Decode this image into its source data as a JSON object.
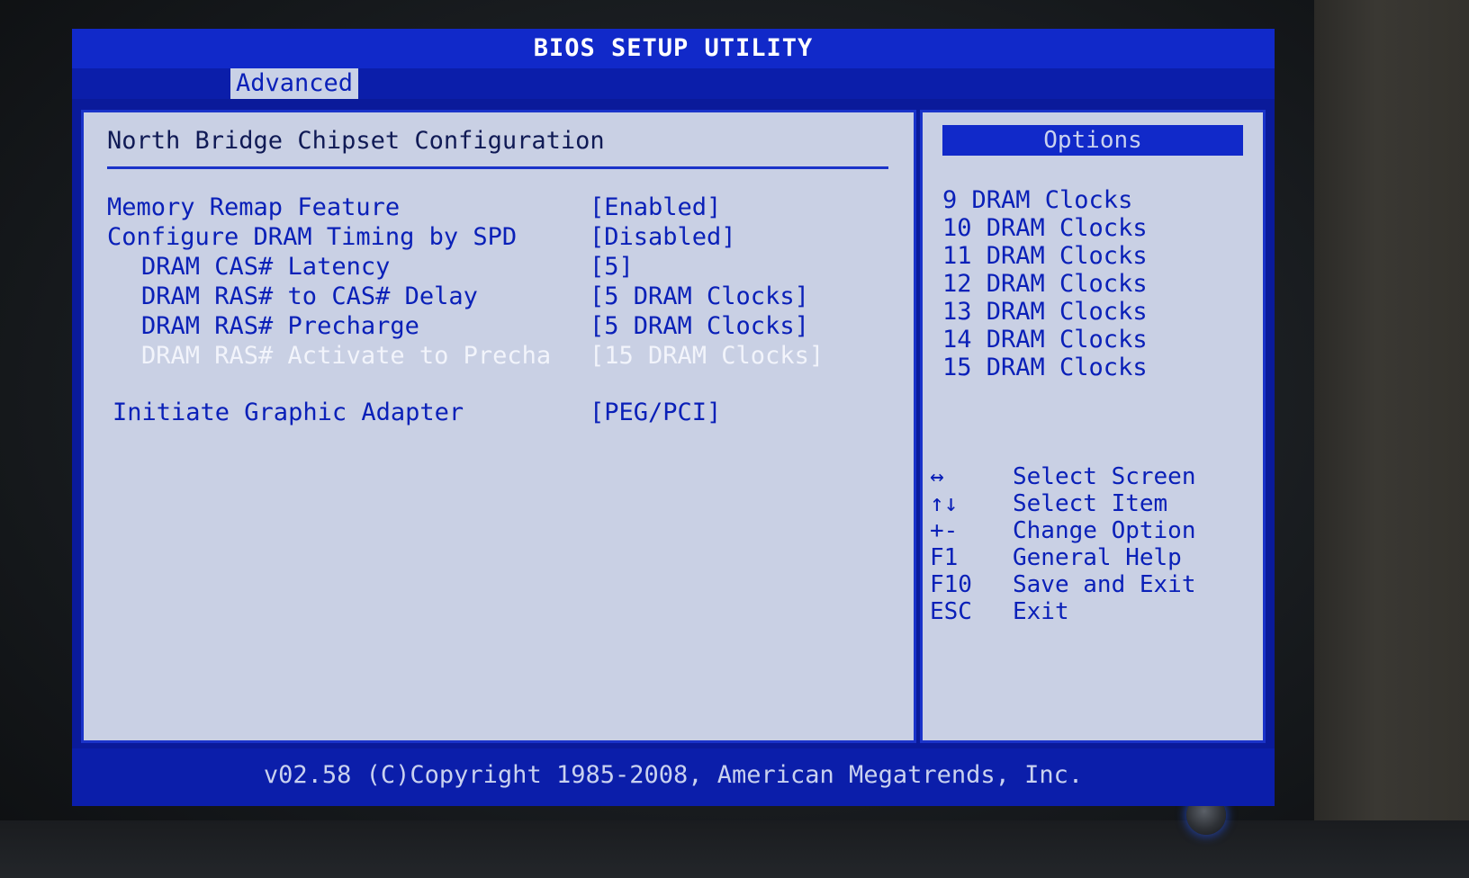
{
  "header": {
    "title": "BIOS SETUP UTILITY",
    "active_tab": "Advanced"
  },
  "main": {
    "title": "North Bridge Chipset Configuration",
    "settings": [
      {
        "label": "Memory Remap Feature",
        "value": "[Enabled]",
        "state": "normal"
      },
      {
        "label": "Configure DRAM Timing by SPD",
        "value": "[Disabled]",
        "state": "normal"
      },
      {
        "label": "DRAM CAS# Latency",
        "value": "[5]",
        "state": "normal"
      },
      {
        "label": "DRAM RAS# to CAS# Delay",
        "value": "[5 DRAM Clocks]",
        "state": "normal"
      },
      {
        "label": "DRAM RAS# Precharge",
        "value": "[5 DRAM Clocks]",
        "state": "normal"
      },
      {
        "label": "DRAM RAS# Activate to Precha",
        "value": "[15 DRAM Clocks]",
        "state": "selected"
      },
      {
        "label": "Initiate Graphic Adapter",
        "value": "[PEG/PCI]",
        "state": "normal"
      }
    ]
  },
  "side": {
    "options_title": "Options",
    "options": [
      "9 DRAM Clocks",
      "10 DRAM Clocks",
      "11 DRAM Clocks",
      "12 DRAM Clocks",
      "13 DRAM Clocks",
      "14 DRAM Clocks",
      "15 DRAM Clocks"
    ],
    "keys": [
      {
        "key": "↔",
        "desc": "Select Screen"
      },
      {
        "key": "↑↓",
        "desc": "Select Item"
      },
      {
        "key": "+-",
        "desc": "Change Option"
      },
      {
        "key": "F1",
        "desc": "General Help"
      },
      {
        "key": "F10",
        "desc": "Save and Exit"
      },
      {
        "key": "ESC",
        "desc": "Exit"
      }
    ]
  },
  "footer": {
    "copyright": "v02.58 (C)Copyright 1985-2008, American Megatrends, Inc."
  },
  "colors": {
    "screen_blue": "#0a1a9a",
    "title_blue": "#1129c9",
    "panel_bg": "#c9d0e4",
    "text_blue": "#0a20b8",
    "highlight_text": "#f2f4fb"
  }
}
